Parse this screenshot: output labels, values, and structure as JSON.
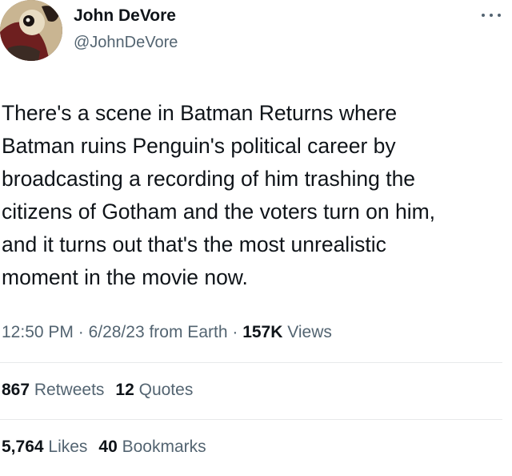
{
  "author": {
    "display_name": "John DeVore",
    "handle": "@JohnDeVore"
  },
  "tweet": {
    "text": "There's a scene in Batman Returns where\nBatman ruins Penguin's political career by\nbroadcasting a recording of him trashing the\ncitizens of Gotham and the voters turn on him,\nand it turns out that's the most unrealistic\nmoment in the movie now."
  },
  "meta": {
    "time": "12:50 PM",
    "sep1": " · ",
    "date": "6/28/23",
    "source": " from Earth",
    "sep2": " · ",
    "views_count": "157K",
    "views_label": " Views"
  },
  "stats": {
    "retweets_count": "867",
    "retweets_label": " Retweets",
    "quotes_count": "12",
    "quotes_label": " Quotes",
    "likes_count": "5,764",
    "likes_label": " Likes",
    "bookmarks_count": "40",
    "bookmarks_label": " Bookmarks"
  },
  "icons": {
    "more": "more-horizontal-icon"
  }
}
